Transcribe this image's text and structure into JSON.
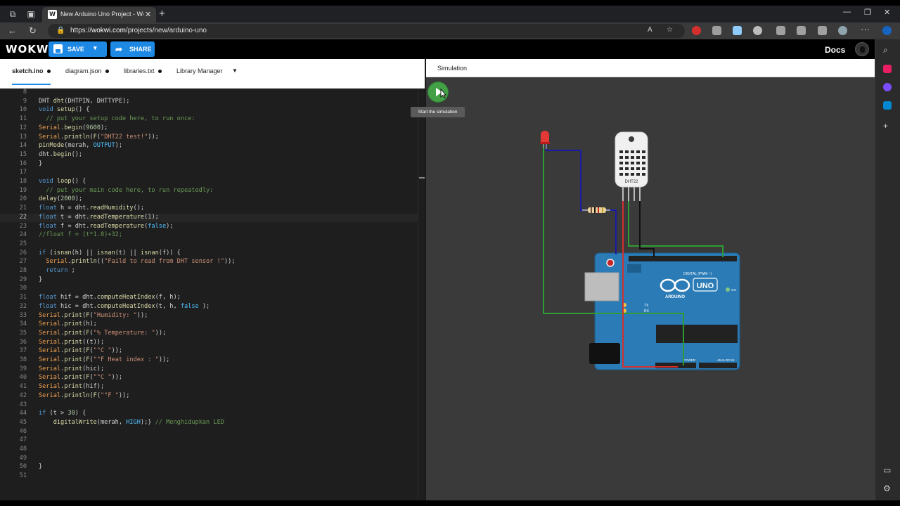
{
  "browser": {
    "tab_title": "New Arduino Uno Project - Wokwi",
    "favicon_letter": "W",
    "url_prefix": "https://",
    "url_host": "wokwi.com",
    "url_path": "/projects/new/arduino-uno"
  },
  "header": {
    "logo": "WOKWI",
    "save_label": "SAVE",
    "share_label": "SHARE",
    "docs_label": "Docs"
  },
  "file_tabs": [
    "sketch.ino",
    "diagram.json",
    "libraries.txt",
    "Library Manager"
  ],
  "simulation": {
    "title": "Simulation",
    "tooltip": "Start the simulation",
    "sensor_label": "DHT22",
    "board_model": "UNO",
    "board_brand": "ARDUINO",
    "digital_label": "DIGITAL (PWM ~)",
    "power_label": "POWER",
    "analog_label": "ANALOG IN",
    "tx_label": "TX",
    "rx_label": "RX",
    "on_label": "ON"
  },
  "code": {
    "current_line": 22,
    "lines": [
      {
        "n": 8,
        "t": ""
      },
      {
        "n": 9,
        "t": "DHT dht(DHTPIN, DHTTYPE);"
      },
      {
        "n": 10,
        "t": "void setup() {"
      },
      {
        "n": 11,
        "t": "  // put your setup code here, to run once:"
      },
      {
        "n": 12,
        "t": "Serial.begin(9600);"
      },
      {
        "n": 13,
        "t": "Serial.println(F(\"DHT22 test!\"));"
      },
      {
        "n": 14,
        "t": "pinMode(merah, OUTPUT);"
      },
      {
        "n": 15,
        "t": "dht.begin();"
      },
      {
        "n": 16,
        "t": "}"
      },
      {
        "n": 17,
        "t": ""
      },
      {
        "n": 18,
        "t": "void loop() {"
      },
      {
        "n": 19,
        "t": "  // put your main code here, to run repeatedly:"
      },
      {
        "n": 20,
        "t": "delay(2000);"
      },
      {
        "n": 21,
        "t": "float h = dht.readHumidity();"
      },
      {
        "n": 22,
        "t": "float t = dht.readTemperature(1);"
      },
      {
        "n": 23,
        "t": "float f = dht.readTemperature(false);"
      },
      {
        "n": 24,
        "t": "//float f = (t*1.8)+32;"
      },
      {
        "n": 25,
        "t": ""
      },
      {
        "n": 26,
        "t": "if (isnan(h) || isnan(t) || isnan(f)) {"
      },
      {
        "n": 27,
        "t": "  Serial.println((\"Faild to read from DHT sensor !\"));"
      },
      {
        "n": 28,
        "t": "  return ;"
      },
      {
        "n": 29,
        "t": "}"
      },
      {
        "n": 30,
        "t": ""
      },
      {
        "n": 31,
        "t": "float hif = dht.computeHeatIndex(f, h);"
      },
      {
        "n": 32,
        "t": "float hic = dht.computeHeatIndex(t, h, false );"
      },
      {
        "n": 33,
        "t": "Serial.print(F(\"Humidity: \"));"
      },
      {
        "n": 34,
        "t": "Serial.print(h);"
      },
      {
        "n": 35,
        "t": "Serial.print(F(\"% Temperature: \"));"
      },
      {
        "n": 36,
        "t": "Serial.print((t));"
      },
      {
        "n": 37,
        "t": "Serial.print(F(\"°C \"));"
      },
      {
        "n": 38,
        "t": "Serial.print(F(\"°F Heat index : \"));"
      },
      {
        "n": 39,
        "t": "Serial.print(hic);"
      },
      {
        "n": 40,
        "t": "Serial.print(F(\"°C \"));"
      },
      {
        "n": 41,
        "t": "Serial.print(hif);"
      },
      {
        "n": 42,
        "t": "Serial.println(F(\"°F \"));"
      },
      {
        "n": 43,
        "t": ""
      },
      {
        "n": 44,
        "t": "if (t > 30) {"
      },
      {
        "n": 45,
        "t": "    digitalWrite(merah, HIGH);} // Menghidupkan LED"
      },
      {
        "n": 46,
        "t": ""
      },
      {
        "n": 47,
        "t": ""
      },
      {
        "n": 48,
        "t": ""
      },
      {
        "n": 49,
        "t": ""
      },
      {
        "n": 50,
        "t": "}"
      },
      {
        "n": 51,
        "t": ""
      }
    ]
  },
  "colors": {
    "accent": "#1e88e5",
    "run": "#43a047",
    "board": "#2a7bb6",
    "wire_red": "#d32f2f",
    "wire_blue": "#1a1aa8",
    "wire_green": "#2e9d33",
    "wire_black": "#111111"
  }
}
